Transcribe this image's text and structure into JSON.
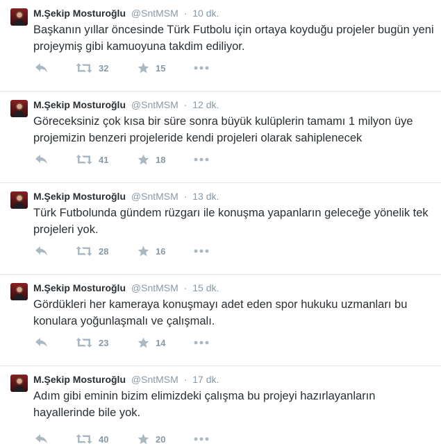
{
  "colors": {
    "name": "#292f33",
    "meta": "#8899a6",
    "action_icon": "#aab8c2",
    "divider": "#e1e8ed"
  },
  "icons": {
    "reply": "reply-icon",
    "retweet": "retweet-icon",
    "favorite": "star-icon",
    "more": "more-icon"
  },
  "tweets": [
    {
      "fullname": "M.Şekip Mosturoğlu",
      "username": "@SntMSM",
      "separator": "·",
      "time": "10 dk.",
      "text": "Başkanın yıllar öncesinde Türk Futbolu için ortaya koyduğu projeler bugün yeni projeymiş gibi kamuoyuna takdim ediliyor.",
      "retweets": "32",
      "favorites": "15"
    },
    {
      "fullname": "M.Şekip Mosturoğlu",
      "username": "@SntMSM",
      "separator": "·",
      "time": "12 dk.",
      "text": "Göreceksiniz çok kısa bir süre sonra büyük kulüplerin tamamı 1 milyon üye projemizin benzeri projeleride kendi projeleri olarak sahiplenecek",
      "retweets": "41",
      "favorites": "18"
    },
    {
      "fullname": "M.Şekip Mosturoğlu",
      "username": "@SntMSM",
      "separator": "·",
      "time": "13 dk.",
      "text": "Türk Futbolunda gündem rüzgarı ile konuşma yapanların geleceğe yönelik tek projeleri yok.",
      "retweets": "28",
      "favorites": "16"
    },
    {
      "fullname": "M.Şekip Mosturoğlu",
      "username": "@SntMSM",
      "separator": "·",
      "time": "15 dk.",
      "text": "Gördükleri her kameraya konuşmayı adet eden spor hukuku uzmanları bu konulara yoğunlaşmalı ve çalışmalı.",
      "retweets": "23",
      "favorites": "14"
    },
    {
      "fullname": "M.Şekip Mosturoğlu",
      "username": "@SntMSM",
      "separator": "·",
      "time": "17 dk.",
      "text": "Adım gibi eminin bizim elimizdeki çalışma bu projeyi hazırlayanların hayallerinde bile yok.",
      "retweets": "40",
      "favorites": "20"
    }
  ]
}
